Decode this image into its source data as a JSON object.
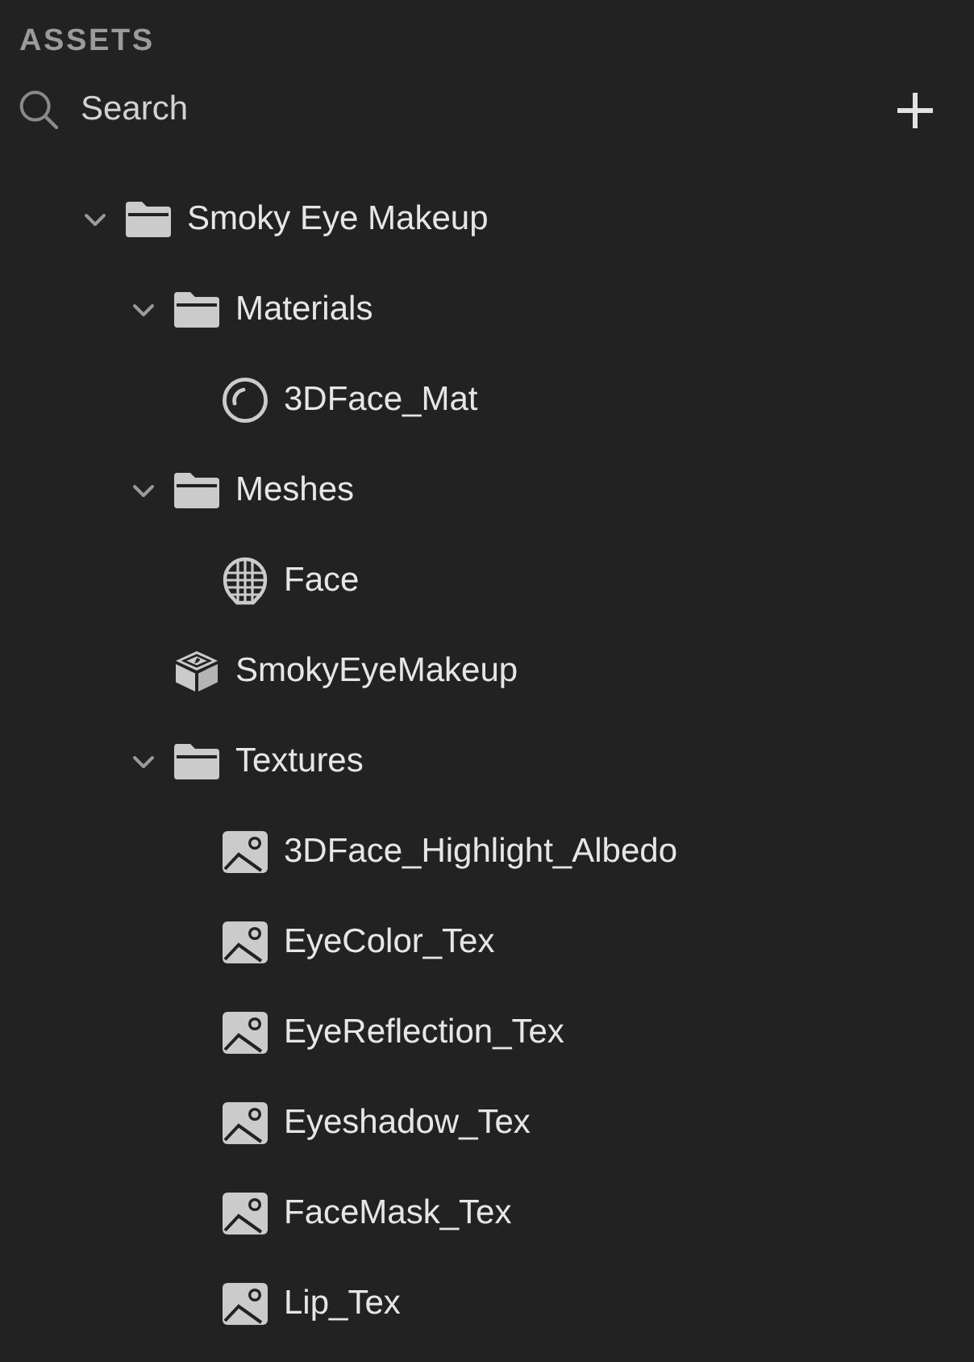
{
  "panel": {
    "title": "ASSETS"
  },
  "search": {
    "placeholder": "Search"
  },
  "tree": [
    {
      "name": "Smoky Eye Makeup",
      "kind": "folder",
      "expanded": true,
      "children": [
        {
          "name": "Materials",
          "kind": "folder",
          "expanded": true,
          "children": [
            {
              "name": "3DFace_Mat",
              "kind": "material"
            }
          ]
        },
        {
          "name": "Meshes",
          "kind": "folder",
          "expanded": true,
          "children": [
            {
              "name": "Face",
              "kind": "mesh"
            }
          ]
        },
        {
          "name": "SmokyEyeMakeup",
          "kind": "effect"
        },
        {
          "name": "Textures",
          "kind": "folder",
          "expanded": true,
          "children": [
            {
              "name": "3DFace_Highlight_Albedo",
              "kind": "texture"
            },
            {
              "name": "EyeColor_Tex",
              "kind": "texture"
            },
            {
              "name": "EyeReflection_Tex",
              "kind": "texture"
            },
            {
              "name": "Eyeshadow_Tex",
              "kind": "texture"
            },
            {
              "name": "FaceMask_Tex",
              "kind": "texture"
            },
            {
              "name": "Lip_Tex",
              "kind": "texture"
            }
          ]
        }
      ]
    }
  ]
}
